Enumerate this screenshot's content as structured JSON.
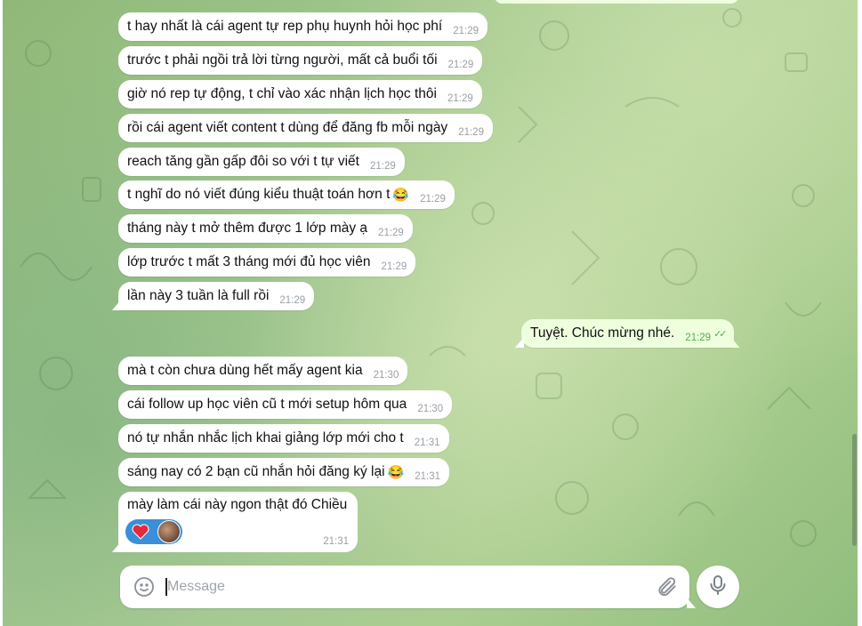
{
  "messages": [
    {
      "text": "t hay nhất là cái agent tự rep phụ huynh hỏi học phí",
      "time": "21:29"
    },
    {
      "text": "trước t phải ngồi trả lời từng người, mất cả buổi tối",
      "time": "21:29"
    },
    {
      "text": "giờ nó rep tự động, t chỉ vào xác nhận lịch học thôi",
      "time": "21:29"
    },
    {
      "text": "rồi cái agent viết content t dùng để đăng fb mỗi ngày",
      "time": "21:29"
    },
    {
      "text": "reach tăng gần gấp đôi so với t tự viết",
      "time": "21:29"
    },
    {
      "text": "t nghĩ do nó viết đúng kiểu thuật toán hơn t",
      "emoji": "😂",
      "time": "21:29"
    },
    {
      "text": "tháng này t mở thêm được 1 lớp mày ạ",
      "time": "21:29"
    },
    {
      "text": "lớp trước t mất 3 tháng mới đủ học viên",
      "time": "21:29"
    },
    {
      "text": "lần này 3 tuần là full rồi",
      "time": "21:29"
    },
    {
      "text": "Tuyệt. Chúc mừng nhé.",
      "time": "21:29",
      "status": "read"
    },
    {
      "text": "mà t còn chưa dùng hết mấy agent kia",
      "time": "21:30"
    },
    {
      "text": "cái follow up học viên cũ t mới setup hôm qua",
      "time": "21:30"
    },
    {
      "text": "nó tự nhắn nhắc lịch khai giảng lớp mới cho t",
      "time": "21:31"
    },
    {
      "text": "sáng nay có 2 bạn cũ nhắn hỏi đăng ký lại",
      "emoji": "😂",
      "time": "21:31"
    },
    {
      "text": "mày làm cái này ngon thật đó Chiều",
      "time": "21:31",
      "reaction": "❤️"
    }
  ],
  "composer": {
    "placeholder": "Message"
  },
  "colors": {
    "incoming": "#ffffff",
    "outgoing": "#eeffde",
    "reaction": "#3a8fd6",
    "read_check": "#4fae4e"
  },
  "icons": {
    "emoji": "smile-icon",
    "attach": "paperclip-icon",
    "voice": "microphone-icon"
  }
}
